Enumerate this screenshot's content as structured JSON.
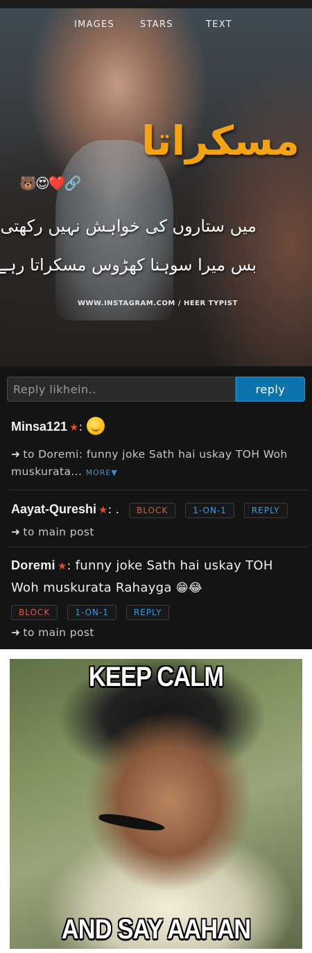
{
  "post": {
    "tabs": [
      "IMAGES",
      "STARS",
      "TEXT"
    ],
    "urdu_title": "مسکراتا",
    "emojis": "🐻😍❤️🔗",
    "urdu_line1": "میں ستاروں کی خواہش نہیں رکھتی",
    "urdu_line2": "بس میرا سوہنا کھڑوس مسکراتا رہے",
    "watermark": "WWW.INSTAGRAM.COM / HEER TYPIST"
  },
  "reply_bar": {
    "placeholder": "Reply likhein..",
    "button_label": "reply"
  },
  "comments": [
    {
      "user": "Minsa121",
      "colon": ":",
      "reply_text": "to Doremi: funny joke Sath hai uskay TOH Woh muskurata...",
      "more_label": "MORE▼"
    },
    {
      "user": "Aayat-Qureshi",
      "colon": ": .",
      "actions": [
        "BLOCK",
        "1-ON-1",
        "REPLY"
      ],
      "link_text": "to main post"
    },
    {
      "user": "Doremi",
      "colon": ":",
      "text": "funny joke Sath hai uskay TOH Woh muskurata Rahayga",
      "emoji": "😁😂",
      "actions": [
        "BLOCK",
        "1-ON-1",
        "REPLY"
      ],
      "link_text": "to main post"
    }
  ],
  "meme": {
    "top_text": "KEEP CALM",
    "bottom_text": "AND SAY AAHAN"
  },
  "colors": {
    "background": "#141414",
    "accent_blue": "#0b74ad",
    "title_orange": "#f3a314",
    "block_red": "#e2583e",
    "star": "#e0512b"
  }
}
